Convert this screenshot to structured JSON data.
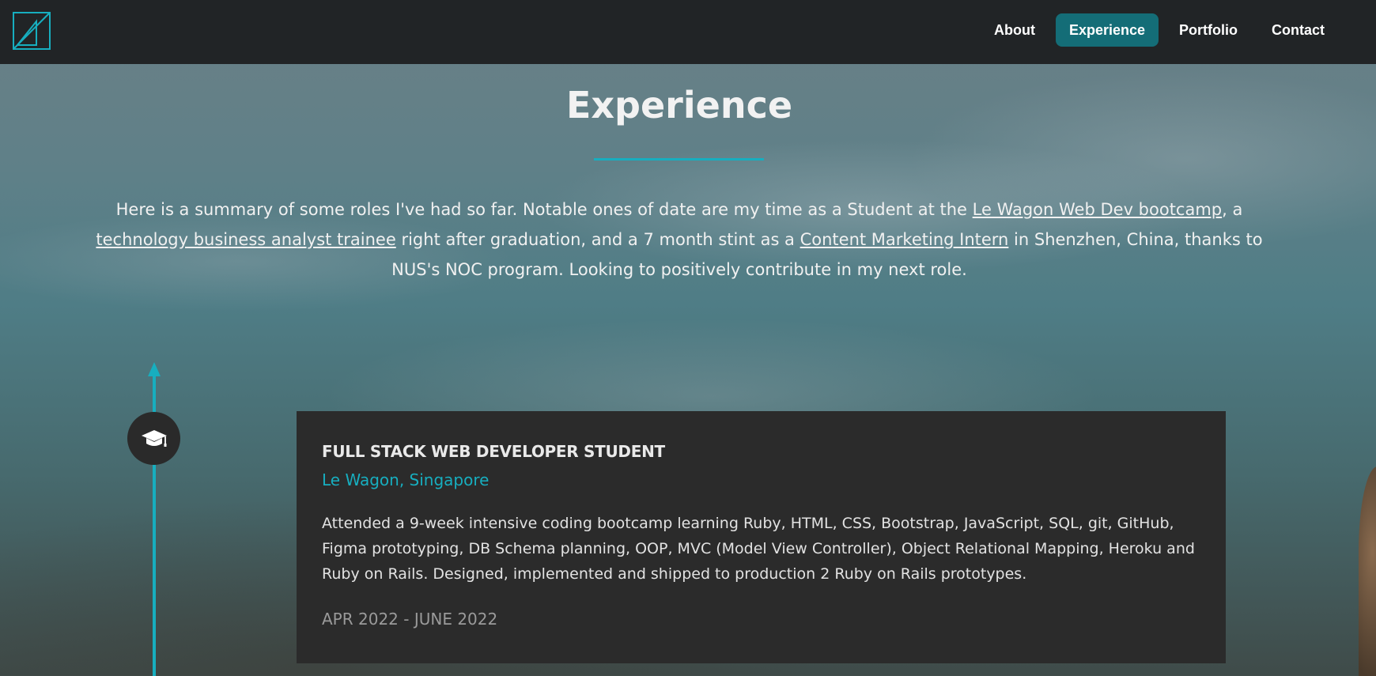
{
  "nav": {
    "logo_icon": "logo-triangle-icon",
    "links": [
      "About",
      "Experience",
      "Portfolio",
      "Contact"
    ],
    "active": "Experience"
  },
  "section": {
    "title": "Experience",
    "intro": {
      "part1": "Here is a summary of some roles I've had so far. Notable ones of date are my time as a Student at the ",
      "link1": "Le Wagon Web Dev bootcamp",
      "part2": ", a ",
      "link2": "technology business analyst trainee",
      "part3": " right after graduation, and a 7 month stint as a ",
      "link3": "Content Marketing Intern",
      "part4": " in Shenzhen, China, thanks to NUS's NOC program. Looking to positively contribute in my next role."
    }
  },
  "timeline": {
    "icon": "graduation-cap-icon",
    "entries": [
      {
        "role": "FULL STACK WEB DEVELOPER STUDENT",
        "company": "Le Wagon, Singapore",
        "description": "Attended a 9-week intensive coding bootcamp learning Ruby, HTML, CSS, Bootstrap, JavaScript, SQL, git, GitHub, Figma prototyping, DB Schema planning, OOP, MVC (Model View Controller), Object Relational Mapping, Heroku and Ruby on Rails. Designed, implemented and shipped to production 2 Ruby on Rails prototypes.",
        "dates": "APR 2022 - JUNE 2022"
      }
    ]
  },
  "colors": {
    "accent": "#17aebf",
    "nav_bg": "#212426",
    "active_tab": "#146d77",
    "card_bg": "#2b2b2b"
  }
}
